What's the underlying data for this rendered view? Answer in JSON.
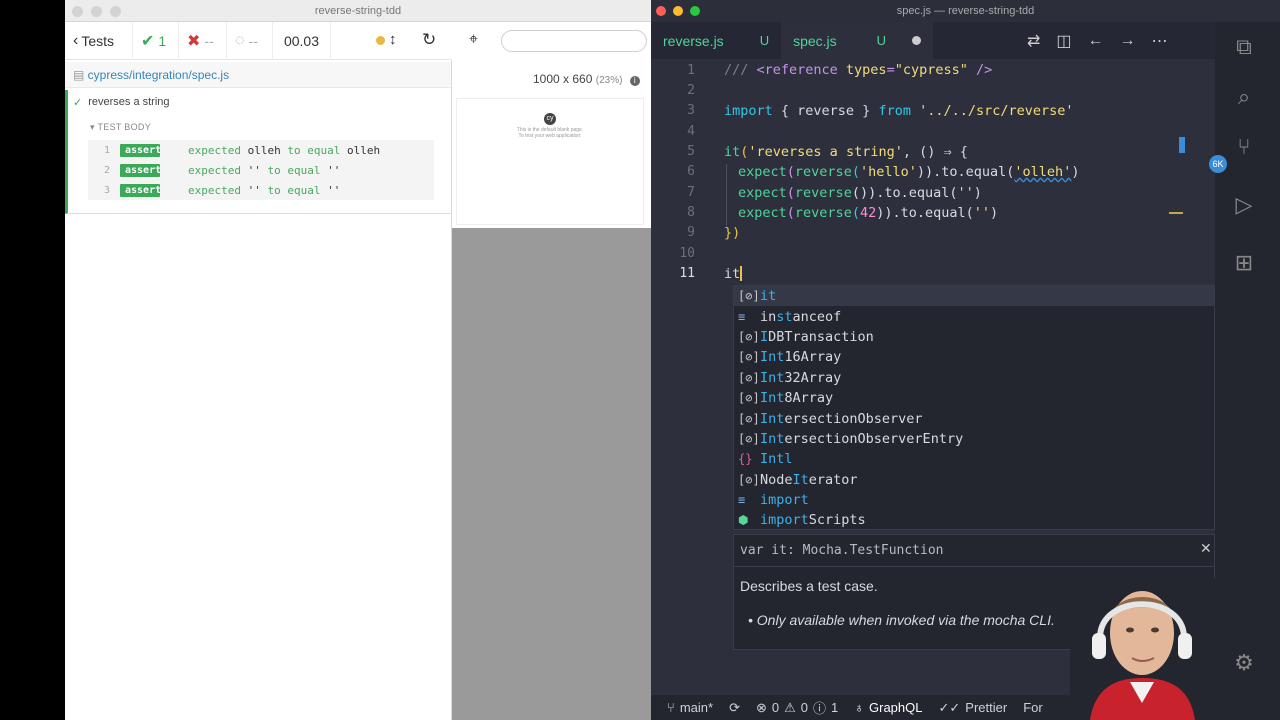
{
  "cypress": {
    "window_title": "reverse-string-tdd",
    "tests_label": "Tests",
    "passed_count": "1",
    "failed_count": "--",
    "pending_count": "--",
    "duration": "00.03",
    "spec_path": "cypress/integration/spec.js",
    "test_name": "reverses a string",
    "test_body_label": "TEST BODY",
    "commands": [
      {
        "n": "1",
        "badge": "assert",
        "pre": "expected ",
        "a": "olleh",
        "mid": " to equal ",
        "b": "olleh"
      },
      {
        "n": "2",
        "badge": "assert",
        "pre": "expected ",
        "a": "''",
        "mid": " to equal ",
        "b": "''"
      },
      {
        "n": "3",
        "badge": "assert",
        "pre": "expected ",
        "a": "''",
        "mid": " to equal ",
        "b": "''"
      }
    ],
    "viewport_size": "1000 x 660",
    "viewport_scale": "(23%)",
    "app_preview_lines": [
      "This is the default blank page.",
      "To test your web application:"
    ]
  },
  "vscode": {
    "window_title": "spec.js — reverse-string-tdd",
    "tabs": [
      {
        "label": "reverse.js",
        "status": "U"
      },
      {
        "label": "spec.js",
        "status": "U"
      }
    ],
    "lines": [
      "1",
      "2",
      "3",
      "4",
      "5",
      "6",
      "7",
      "8",
      "9",
      "10",
      "11"
    ],
    "code": {
      "l1_a": "/// ",
      "l1_b": "<reference",
      "l1_c": " types",
      "l1_d": "=",
      "l1_e": "\"cypress\"",
      "l1_f": " />",
      "l3_a": "import",
      "l3_b": " { reverse } ",
      "l3_c": "from",
      "l3_d": " '../../src/reverse'",
      "l5_a": "it",
      "l5_b": "(",
      "l5_c": "'reverses a string'",
      "l5_d": ", () ⇒ {",
      "l6_a": "expect",
      "l6_b": "(",
      "l6_c": "reverse",
      "l6_d": "(",
      "l6_e": "'hello'",
      "l6_f": ")).to.equal(",
      "l6_g": "'olleh'",
      "l6_h": ")",
      "l7_a": "expect",
      "l7_b": "(",
      "l7_c": "reverse",
      "l7_d": "()).to.equal(",
      "l7_e": "''",
      "l7_f": ")",
      "l8_a": "expect",
      "l8_b": "(",
      "l8_c": "reverse",
      "l8_d": "(",
      "l8_e": "42",
      "l8_f": ")).to.equal(",
      "l8_g": "''",
      "l8_h": ")",
      "l9": "})",
      "l11": "it"
    },
    "suggestions": [
      {
        "icon": "[⊘]",
        "match": "it",
        "rest": ""
      },
      {
        "icon": "≡",
        "match": "",
        "rest": "instanceof"
      },
      {
        "icon": "[⊘]",
        "match": "",
        "rest": "IDBTransaction"
      },
      {
        "icon": "[⊘]",
        "match": "Int",
        "rest": "16Array"
      },
      {
        "icon": "[⊘]",
        "match": "Int",
        "rest": "32Array"
      },
      {
        "icon": "[⊘]",
        "match": "Int",
        "rest": "8Array"
      },
      {
        "icon": "[⊘]",
        "match": "Int",
        "rest": "ersectionObserver"
      },
      {
        "icon": "[⊘]",
        "match": "Int",
        "rest": "ersectionObserverEntry"
      },
      {
        "icon": "{}",
        "match": "Intl",
        "rest": ""
      },
      {
        "icon": "[⊘]",
        "match": "",
        "rest": "NodeIterator"
      },
      {
        "icon": "≡",
        "match": "import",
        "rest": ""
      },
      {
        "icon": "⬢",
        "match": "import",
        "rest": "Scripts"
      }
    ],
    "doc": {
      "signature": "var it: Mocha.TestFunction",
      "description": "Describes a test case.",
      "note": "Only available when invoked via the mocha CLI."
    },
    "status": {
      "branch": "main*",
      "errors": "0",
      "warnings": "0",
      "infos": "1",
      "graphql": "GraphQL",
      "prettier": "Prettier",
      "extra": "For"
    },
    "badge_count": "6K"
  },
  "colors": {
    "cypress_green": "#3aaa59",
    "vscode_bg": "#2d303c",
    "keyword": "#32c7e8",
    "string": "#f2dc7a",
    "untracked": "#4fd39a"
  }
}
